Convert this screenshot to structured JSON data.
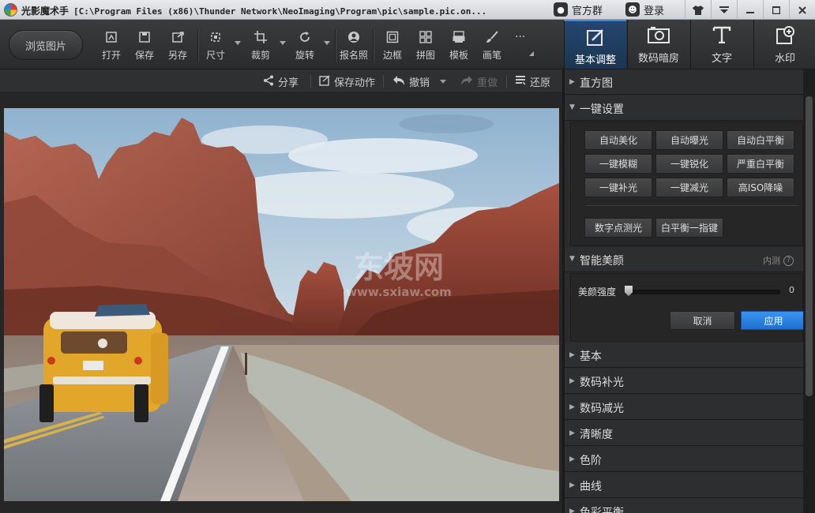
{
  "titlebar": {
    "app_name": "光影魔术手",
    "path": "[C:\\Program Files (x86)\\Thunder Network\\NeoImaging\\Program\\pic\\sample.pic.on...",
    "official_group": "官方群",
    "login": "登录",
    "icons": [
      "app-logo-icon",
      "chat-icon",
      "user-icon",
      "shirt-icon",
      "menu-icon",
      "minimize-icon",
      "maximize-icon",
      "close-icon"
    ]
  },
  "toolbar": {
    "browse": "浏览图片",
    "tools": [
      {
        "label": "打开",
        "icon": "open-icon"
      },
      {
        "label": "保存",
        "icon": "save-icon"
      },
      {
        "label": "另存",
        "icon": "save-as-icon"
      },
      {
        "label": "尺寸",
        "icon": "resize-icon"
      },
      {
        "label": "裁剪",
        "icon": "crop-icon"
      },
      {
        "label": "旋转",
        "icon": "rotate-icon"
      },
      {
        "label": "报名照",
        "icon": "id-photo-icon"
      },
      {
        "label": "边框",
        "icon": "border-icon"
      },
      {
        "label": "拼图",
        "icon": "collage-icon"
      },
      {
        "label": "模板",
        "icon": "template-icon"
      },
      {
        "label": "画笔",
        "icon": "brush-icon"
      }
    ],
    "more": "···"
  },
  "right_tabs": [
    {
      "label": "基本调整",
      "icon": "basic-adjust-icon",
      "active": true
    },
    {
      "label": "数码暗房",
      "icon": "darkroom-icon",
      "active": false
    },
    {
      "label": "文字",
      "icon": "text-icon",
      "active": false
    },
    {
      "label": "水印",
      "icon": "watermark-icon",
      "active": false
    }
  ],
  "actionbar": {
    "share": "分享",
    "save_action": "保存动作",
    "undo": "撤销",
    "redo": "重做",
    "restore": "还原"
  },
  "panel": {
    "histogram": "直方图",
    "one_click": "一键设置",
    "presets": [
      [
        "自动美化",
        "自动曝光",
        "自动白平衡"
      ],
      [
        "一键模糊",
        "一键锐化",
        "严重白平衡"
      ],
      [
        "一键补光",
        "一键减光",
        "高ISO降噪"
      ]
    ],
    "presets_extra": [
      "数字点测光",
      "白平衡一指键"
    ],
    "beauty_title": "智能美颜",
    "beauty_beta": "内测",
    "beauty_strength_label": "美颜强度",
    "beauty_strength_value": "0",
    "beauty_strength": 0,
    "cancel": "取消",
    "apply": "应用",
    "sections": [
      "基本",
      "数码补光",
      "数码减光",
      "清晰度",
      "色阶",
      "曲线",
      "色彩平衡"
    ]
  },
  "watermark": {
    "line1": "东坡网",
    "line2": "www.sxiaw.com"
  },
  "colors": {
    "accent": "#1f6fd1",
    "tab_active": "#24466e",
    "panel_bg": "#2b2b2b"
  }
}
